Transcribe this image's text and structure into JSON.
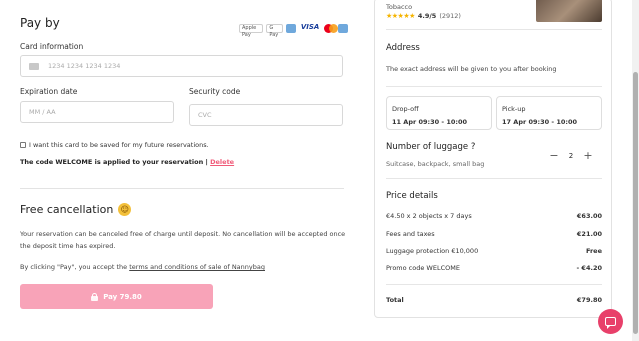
{
  "payment": {
    "title": "Pay by",
    "card_logos": [
      "Apple Pay",
      "G Pay",
      "Card",
      "VISA",
      "Mastercard",
      "Amex"
    ],
    "card_info_label": "Card information",
    "card_number_placeholder": "1234 1234 1234 1234",
    "expiration_label": "Expiration date",
    "expiration_placeholder": "MM / AA",
    "security_label": "Security code",
    "security_placeholder": "CVC",
    "save_card_label": "I want this card to be saved for my future reservations.",
    "promo_notice": "The code WELCOME is applied to your reservation |",
    "delete_label": "Delete"
  },
  "cancellation": {
    "title": "Free cancellation",
    "emoji": "☺",
    "text": "Your reservation can be canceled free of charge until deposit. No cancellation will be accepted once the deposit time has expired.",
    "terms_prefix": "By clicking \"Pay\", you accept the",
    "terms_link": "terms and conditions of sale of Nannybag",
    "pay_button": "Pay 79.80"
  },
  "summary": {
    "shop_name": "Tobacco",
    "stars": "★★★★★",
    "rating": "4.9/5",
    "review_count": "(2912)",
    "address_title": "Address",
    "address_text": "The exact address will be given to you after booking",
    "dropoff_label": "Drop-off",
    "dropoff_value": "11 Apr 09:30 - 10:00",
    "pickup_label": "Pick-up",
    "pickup_value": "17 Apr 09:30 - 10:00",
    "luggage_title": "Number of luggage ?",
    "luggage_subtitle": "Suitcase, backpack, small bag",
    "luggage_minus": "−",
    "luggage_count": "2",
    "luggage_plus": "+",
    "price_title": "Price details",
    "lines": [
      {
        "label": "€4.50 x 2 objects x 7 days",
        "amount": "€63.00"
      },
      {
        "label": "Fees and taxes",
        "amount": "€21.00"
      },
      {
        "label": "Luggage protection €10,000",
        "amount": "Free"
      },
      {
        "label": "Promo code WELCOME",
        "amount": "- €4.20"
      }
    ],
    "total_label": "Total",
    "total_amount": "€79.80"
  },
  "colors": {
    "accent": "#e8406a",
    "pay_button": "#f8a3b8",
    "star": "#f5b400"
  }
}
